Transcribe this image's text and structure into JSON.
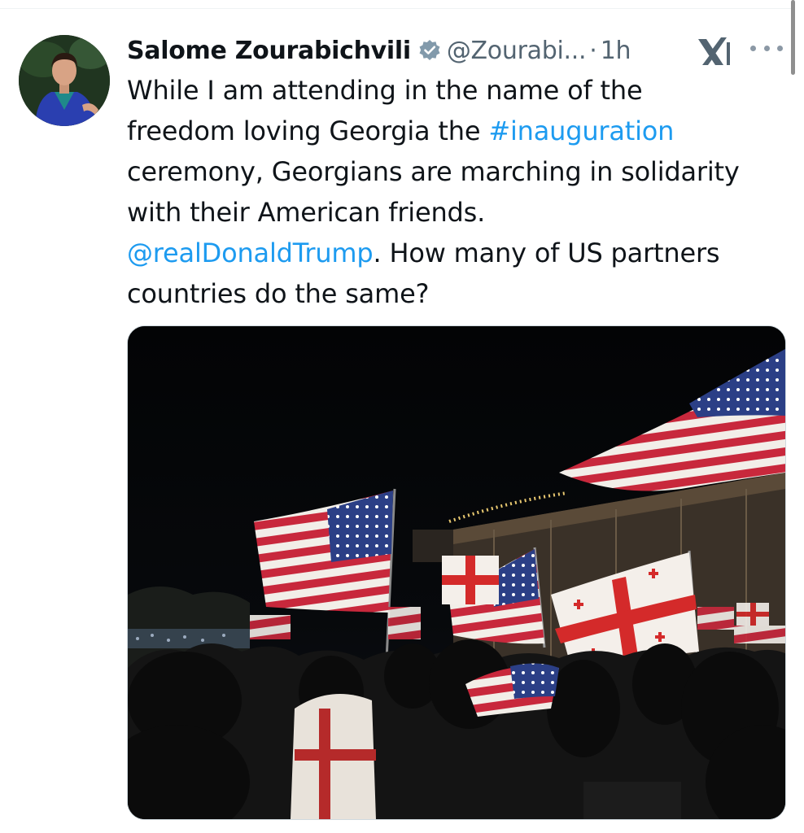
{
  "tweet": {
    "author_name": "Salome Zourabichvili",
    "verified_icon": "verified-badge-icon",
    "handle": "@Zourabi...",
    "separator": "·",
    "time": "1h",
    "text_lines": [
      "While I am attending in the name of the",
      "freedom loving Georgia the ",
      "#inauguration",
      "ceremony, Georgians are marching in solidarity",
      "with their American friends.",
      "@realDonaldTrump",
      ". How many of US partners",
      "countries do the same?"
    ],
    "hashtag": "#inauguration",
    "mention": "@realDonaldTrump",
    "link_color": "#1d9bf0",
    "media": {
      "icon": "photo",
      "subjects": [
        "US flags",
        "Georgian flags",
        "night crowd"
      ]
    }
  },
  "icons": {
    "grok": "grok-icon",
    "more": "more-options-icon"
  }
}
